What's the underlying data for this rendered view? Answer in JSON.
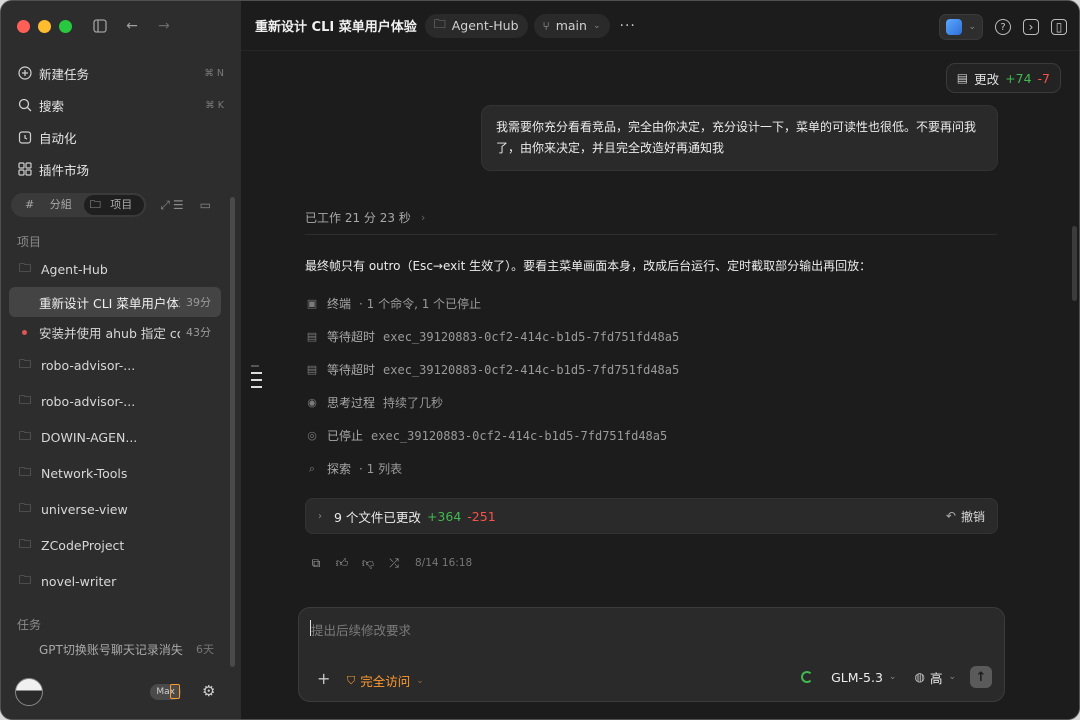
{
  "sidebar": {
    "nav": [
      {
        "label": "新建任务",
        "icon": "plus-circle-icon",
        "shortcut": "⌘ N"
      },
      {
        "label": "搜索",
        "icon": "search-icon",
        "shortcut": "⌘ K"
      },
      {
        "label": "自动化",
        "icon": "clock-icon",
        "shortcut": ""
      },
      {
        "label": "插件市场",
        "icon": "grid-icon",
        "shortcut": ""
      }
    ],
    "segment": {
      "group_label": "分組",
      "project_label": "项目",
      "group_icon": "#"
    },
    "projects_label": "项目",
    "projects": [
      {
        "label": "Agent-Hub",
        "type": "folder"
      },
      {
        "label": "重新设计 CLI 菜单用户体验",
        "type": "task",
        "time": "39分",
        "active": true
      },
      {
        "label": "安装并使用 ahub 指定 co",
        "type": "task-dot",
        "time": "43分"
      },
      {
        "label": "robo-advisor-...",
        "type": "folder"
      },
      {
        "label": "robo-advisor-...",
        "type": "folder"
      },
      {
        "label": "DOWIN-AGEN...",
        "type": "folder"
      },
      {
        "label": "Network-Tools",
        "type": "folder"
      },
      {
        "label": "universe-view",
        "type": "folder"
      },
      {
        "label": "ZCodeProject",
        "type": "folder"
      },
      {
        "label": "novel-writer",
        "type": "folder"
      }
    ],
    "tasks_label": "任务",
    "task_item": {
      "label": "GPT切换账号聊天记录消失",
      "time": "6天"
    },
    "max_badge": "Max"
  },
  "header": {
    "title": "重新设计 CLI 菜单用户体验",
    "project_chip": "Agent-Hub",
    "branch_chip": "main",
    "more": "···"
  },
  "changes_button": {
    "label": "更改",
    "added": "+74",
    "removed": "-7"
  },
  "user_message": "我需要你充分看看竞品，完全由你决定，充分设计一下，菜单的可读性也很低。不要再问我了，由你来决定，并且完全改造好再通知我",
  "worked": {
    "label": "已工作 21 分 23 秒"
  },
  "summary": "最终帧只有 outro（Esc→exit 生效了）。要看主菜单画面本身，改成后台运行、定时截取部分输出再回放：",
  "steps": [
    {
      "icon": "terminal-icon",
      "label": "终端",
      "detail": "· 1 个命令, 1 个已停止",
      "mono": false
    },
    {
      "icon": "file-wait-icon",
      "label": "等待超时",
      "detail": "exec_39120883-0cf2-414c-b1d5-7fd751fd48a5",
      "mono": true
    },
    {
      "icon": "file-wait-icon",
      "label": "等待超时",
      "detail": "exec_39120883-0cf2-414c-b1d5-7fd751fd48a5",
      "mono": true
    },
    {
      "icon": "brain-icon",
      "label": "思考过程",
      "detail": "持续了几秒",
      "mono": false
    },
    {
      "icon": "stop-circle-icon",
      "label": "已停止",
      "detail": "exec_39120883-0cf2-414c-b1d5-7fd751fd48a5",
      "mono": true
    },
    {
      "icon": "search-icon",
      "label": "探索",
      "detail": "· 1 列表",
      "mono": false
    }
  ],
  "files_changed": {
    "label": "9 个文件已更改",
    "added": "+364",
    "removed": "-251",
    "undo": "撤销"
  },
  "message_time": "8/14 16:18",
  "composer": {
    "placeholder": "提出后续修改要求",
    "access": "完全访问",
    "model": "GLM-5.3",
    "effort": "高"
  },
  "colors": {
    "added": "#3fb950",
    "removed": "#f85149",
    "accent": "#ff9a2e"
  }
}
